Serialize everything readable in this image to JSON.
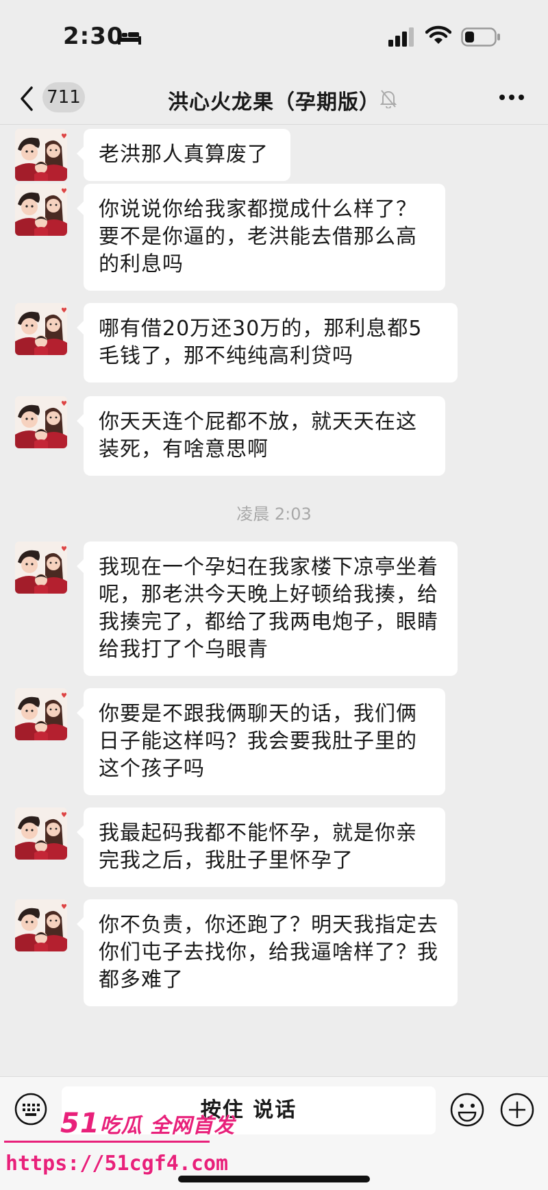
{
  "status_bar": {
    "time": "2:30"
  },
  "nav": {
    "unread_count": "711",
    "title": "洪心火龙果（孕期版）"
  },
  "messages": [
    {
      "text": "老洪那人真算废了"
    },
    {
      "text": "你说说你给我家都搅成什么样了？要不是你逼的，老洪能去借那么高的利息吗"
    },
    {
      "text": "哪有借20万还30万的，那利息都5毛钱了，那不纯纯高利贷吗"
    },
    {
      "text": "你天天连个屁都不放，就天天在这装死，有啥意思啊"
    },
    {
      "text": "我现在一个孕妇在我家楼下凉亭坐着呢，那老洪今天晚上好顿给我揍，给我揍完了，都给了我两电炮子，眼睛给我打了个乌眼青"
    },
    {
      "text": "你要是不跟我俩聊天的话，我们俩日子能这样吗？我会要我肚子里的这个孩子吗"
    },
    {
      "text": "我最起码我都不能怀孕，就是你亲完我之后，我肚子里怀孕了"
    },
    {
      "text": "你不负责，你还跑了？明天我指定去你们屯子去找你，给我逼啥样了？我都多难了"
    }
  ],
  "timestamp": "凌晨 2:03",
  "input_bar": {
    "voice_label": "按住 说话"
  },
  "watermark": {
    "brand_num": "51",
    "brand_text": "吃瓜 全网首发",
    "url": "https://51cgf4.com"
  },
  "icons": [
    "bed-icon",
    "signal-icon",
    "wifi-icon",
    "battery-icon",
    "back-icon",
    "mute-bell-icon",
    "more-icon",
    "keyboard-icon",
    "emoji-icon",
    "plus-icon"
  ]
}
